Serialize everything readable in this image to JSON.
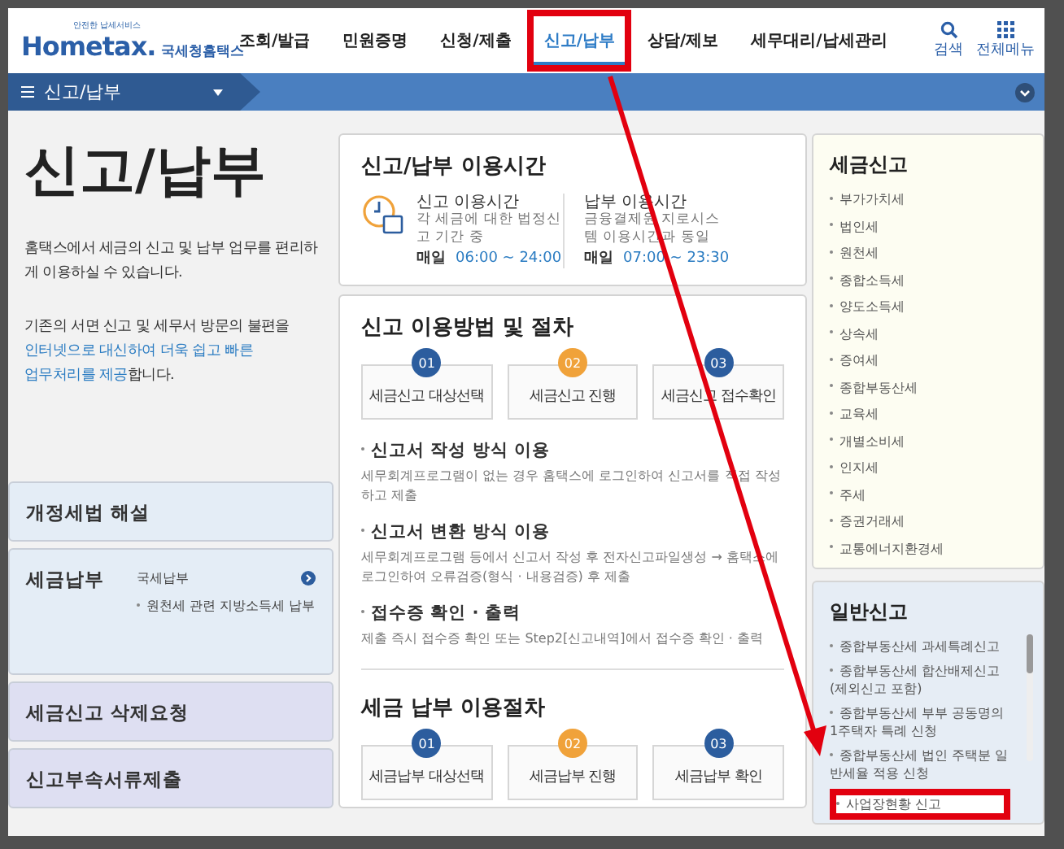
{
  "header": {
    "logo": {
      "brand": "Hometax.",
      "name": "국세청홈택스",
      "tagline": "안전한 납세서비스"
    },
    "nav": [
      {
        "label": "조회/발급",
        "selected": false,
        "highlighted": false
      },
      {
        "label": "민원증명",
        "selected": false,
        "highlighted": false
      },
      {
        "label": "신청/제출",
        "selected": false,
        "highlighted": false
      },
      {
        "label": "신고/납부",
        "selected": true,
        "highlighted": true
      },
      {
        "label": "상담/제보",
        "selected": false,
        "highlighted": false
      },
      {
        "label": "세무대리/납세관리",
        "selected": false,
        "highlighted": false
      }
    ],
    "tools": [
      {
        "kind": "search",
        "label": "검색"
      },
      {
        "kind": "grid",
        "label": "전체메뉴"
      }
    ]
  },
  "breadcrumb": {
    "label": "신고/납부"
  },
  "intro": {
    "title": "신고/납부",
    "text": "홈택스에서 세금의 신고 및 납부 업무를 편리하게 이용하실 수 있습니다.",
    "note_before": "기존의 서면 신고 및 세무서 방문의 불편을",
    "note_link": [
      "인터넷으로 대신하여 더욱 쉽고 빠른",
      "업무처리를 제공"
    ],
    "note_after": "합니다."
  },
  "side_menu": [
    {
      "kind": "plain",
      "label": "개정세법 해설",
      "color": "#e4edf6"
    },
    {
      "kind": "links",
      "label": "세금납부",
      "color": "#e4edf6",
      "links": [
        "국세납부",
        "원천세 관련 지방소득세 납부"
      ]
    },
    {
      "kind": "plain",
      "label": "세금신고 삭제요청",
      "color": "#dedff2"
    },
    {
      "kind": "plain",
      "label": "신고부속서류제출",
      "color": "#dedff2"
    }
  ],
  "hours": {
    "title": "신고/납부 이용시간",
    "blocks": [
      {
        "title": "신고 이용시간",
        "desc": "각 세금에 대한 법정신고 기간 중",
        "day": "매일",
        "time": "06:00 ~ 24:00"
      },
      {
        "title": "납부 이용시간",
        "desc": "금융결제원 지로시스템 이용시간과 동일",
        "day": "매일",
        "time": "07:00 ~ 23:30"
      }
    ]
  },
  "filing": {
    "title": "신고 이용방법 및 절차",
    "steps": [
      {
        "num": "01",
        "label": "세금신고 대상선택",
        "color": "#2c5d9e"
      },
      {
        "num": "02",
        "label": "세금신고 진행",
        "color": "#f0a23a"
      },
      {
        "num": "03",
        "label": "세금신고 접수확인",
        "color": "#2c5d9e"
      }
    ],
    "methods": [
      {
        "title": "신고서 작성 방식 이용",
        "desc": "세무회계프로그램이 없는 경우 홈택스에 로그인하여 신고서를 직접 작성하고 제출"
      },
      {
        "title": "신고서 변환 방식 이용",
        "desc": "세무회계프로그램 등에서 신고서 작성 후 전자신고파일생성 → 홈택스에 로그인하여 오류검증(형식 · 내용검증) 후 제출"
      },
      {
        "title": "접수증 확인 · 출력",
        "desc": "제출 즉시 접수증 확인 또는 Step2[신고내역]에서 접수증 확인 · 출력"
      }
    ]
  },
  "payment": {
    "title": "세금 납부 이용절차",
    "steps": [
      {
        "num": "01",
        "label": "세금납부 대상선택",
        "color": "#2c5d9e"
      },
      {
        "num": "02",
        "label": "세금납부 진행",
        "color": "#f0a23a"
      },
      {
        "num": "03",
        "label": "세금납부 확인",
        "color": "#2c5d9e"
      }
    ]
  },
  "tax_filing": {
    "title": "세금신고",
    "items": [
      "부가가치세",
      "법인세",
      "원천세",
      "종합소득세",
      "양도소득세",
      "상속세",
      "증여세",
      "종합부동산세",
      "교육세",
      "개별소비세",
      "인지세",
      "주세",
      "증권거래세",
      "교통에너지환경세"
    ]
  },
  "general_filing": {
    "title": "일반신고",
    "items": [
      {
        "label": "종합부동산세 과세특례신고",
        "highlighted": false
      },
      {
        "label": "종합부동산세 합산배제신고(제외신고 포함)",
        "highlighted": false
      },
      {
        "label": "종합부동산세 부부 공동명의 1주택자 특례 신청",
        "highlighted": false
      },
      {
        "label": "종합부동산세 법인 주택분 일반세율 적용 신청",
        "highlighted": false
      },
      {
        "label": "사업장현황 신고",
        "highlighted": true
      }
    ]
  },
  "annotation": {
    "arrow": true
  }
}
